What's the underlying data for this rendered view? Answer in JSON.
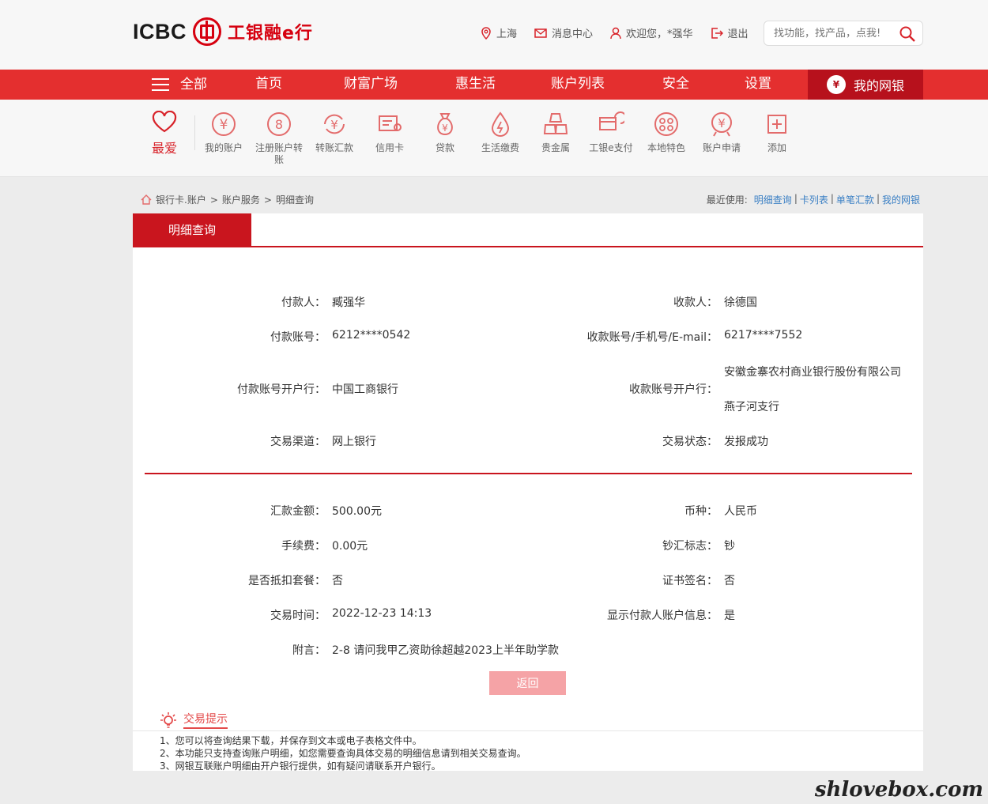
{
  "header": {
    "logo_text": "ICBC",
    "logo_cn": "工银融e行",
    "links": {
      "location": "上海",
      "messages": "消息中心",
      "welcome": "欢迎您，*强华",
      "logout": "退出"
    },
    "search_placeholder": "找功能，找产品，点我!"
  },
  "nav": {
    "all": "全部",
    "items": [
      "首页",
      "财富广场",
      "惠生活",
      "账户列表",
      "安全",
      "设置"
    ],
    "my_bank": "我的网银"
  },
  "quick": {
    "fav_label": "最爱",
    "items": [
      {
        "label": "我的账户",
        "icon": "yuan-circle-icon"
      },
      {
        "label": "注册账户转账",
        "icon": "register-transfer-icon"
      },
      {
        "label": "转账汇款",
        "icon": "transfer-icon"
      },
      {
        "label": "信用卡",
        "icon": "credit-card-icon"
      },
      {
        "label": "贷款",
        "icon": "loan-bag-icon"
      },
      {
        "label": "生活缴费",
        "icon": "utility-drop-icon"
      },
      {
        "label": "贵金属",
        "icon": "gold-bar-icon"
      },
      {
        "label": "工银e支付",
        "icon": "epay-icon"
      },
      {
        "label": "本地特色",
        "icon": "local-feature-icon"
      },
      {
        "label": "账户申请",
        "icon": "account-apply-icon"
      },
      {
        "label": "添加",
        "icon": "add-plus-icon"
      }
    ]
  },
  "breadcrumb": {
    "items": [
      "银行卡.账户",
      ">",
      "账户服务",
      ">",
      "明细查询"
    ]
  },
  "recent": {
    "label": "最近使用:",
    "links": [
      "明细查询",
      "卡列表",
      "单笔汇款",
      "我的网银"
    ]
  },
  "panel": {
    "tab": "明细查询",
    "left": [
      {
        "label": "付款人：",
        "value": "臧强华"
      },
      {
        "label": "付款账号：",
        "value": "6212****0542"
      },
      {
        "label": "付款账号开户行：",
        "value": "中国工商银行"
      },
      {
        "label": "交易渠道：",
        "value": "网上银行"
      },
      {
        "label": "汇款金额：",
        "value": "500.00元"
      },
      {
        "label": "手续费：",
        "value": "0.00元"
      },
      {
        "label": "是否抵扣套餐：",
        "value": "否"
      },
      {
        "label": "交易时间：",
        "value": "2022-12-23 14:13"
      },
      {
        "label": "附言：",
        "value": "2-8 请问我甲乙资助徐超越2023上半年助学款"
      }
    ],
    "right": [
      {
        "label": "收款人：",
        "value": "徐德国"
      },
      {
        "label": "收款账号/手机号/E-mail：",
        "value": "6217****7552"
      },
      {
        "label": "收款账号开户行：",
        "value": "安徽金寨农村商业银行股份有限公司",
        "value2": "燕子河支行"
      },
      {
        "label": "交易状态：",
        "value": "发报成功"
      },
      {
        "label": "币种：",
        "value": "人民币"
      },
      {
        "label": "钞汇标志：",
        "value": "钞"
      },
      {
        "label": "证书签名：",
        "value": "否"
      },
      {
        "label": "显示付款人账户信息：",
        "value": "是"
      }
    ],
    "return_button": "返回"
  },
  "tips": {
    "title": "交易提示",
    "items": [
      "1、您可以将查询结果下载，并保存到文本或电子表格文件中。",
      "2、本功能只支持查询账户明细，如您需要查询具体交易的明细信息请到相关交易查询。",
      "3、网银互联账户明细由开户银行提供，如有疑问请联系开户银行。"
    ]
  },
  "watermark": "shlovebox.com",
  "colors": {
    "brand_red": "#e42f2f",
    "dark_red": "#c9151e",
    "link_blue": "#3a7fc4"
  }
}
